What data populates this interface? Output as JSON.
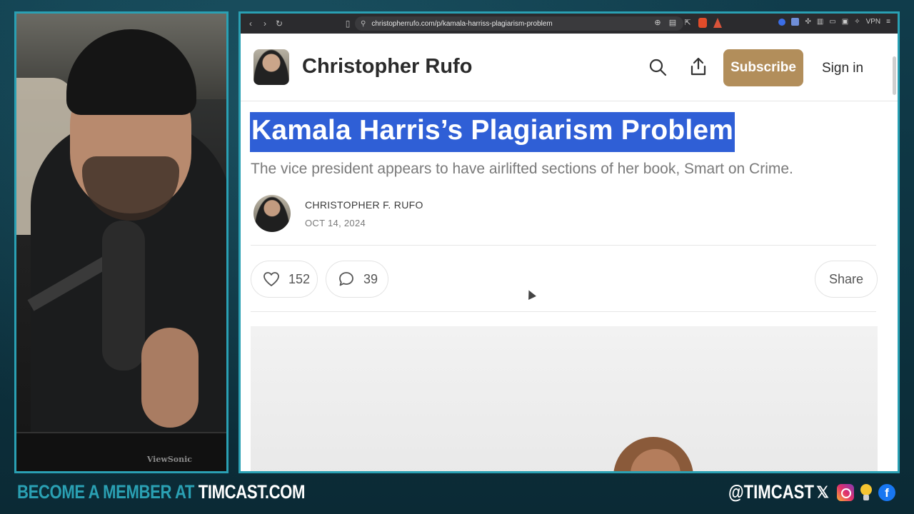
{
  "browser": {
    "url": "christopherrufo.com/p/kamala-harriss-plagiarism-problem",
    "vpn_label": "VPN"
  },
  "site": {
    "name": "Christopher Rufo",
    "subscribe_label": "Subscribe",
    "signin_label": "Sign in"
  },
  "post": {
    "title": "Kamala Harris’s Plagiarism Problem",
    "subtitle": "The vice president appears to have airlifted sections of her book, Smart on Crime.",
    "author": "CHRISTOPHER F. RUFO",
    "date": "OCT 14, 2024",
    "likes": "152",
    "comments": "39",
    "share_label": "Share"
  },
  "webcam": {
    "monitor_brand": "ViewSonic"
  },
  "overlay": {
    "cta_part1": "BECOME A MEMBER AT ",
    "cta_part2": "TIMCAST.COM",
    "handle": "@TIMCAST",
    "colors": {
      "accent": "#2aa0b3",
      "subscribe": "#b28e5b",
      "selection": "#2f5fd6"
    }
  }
}
